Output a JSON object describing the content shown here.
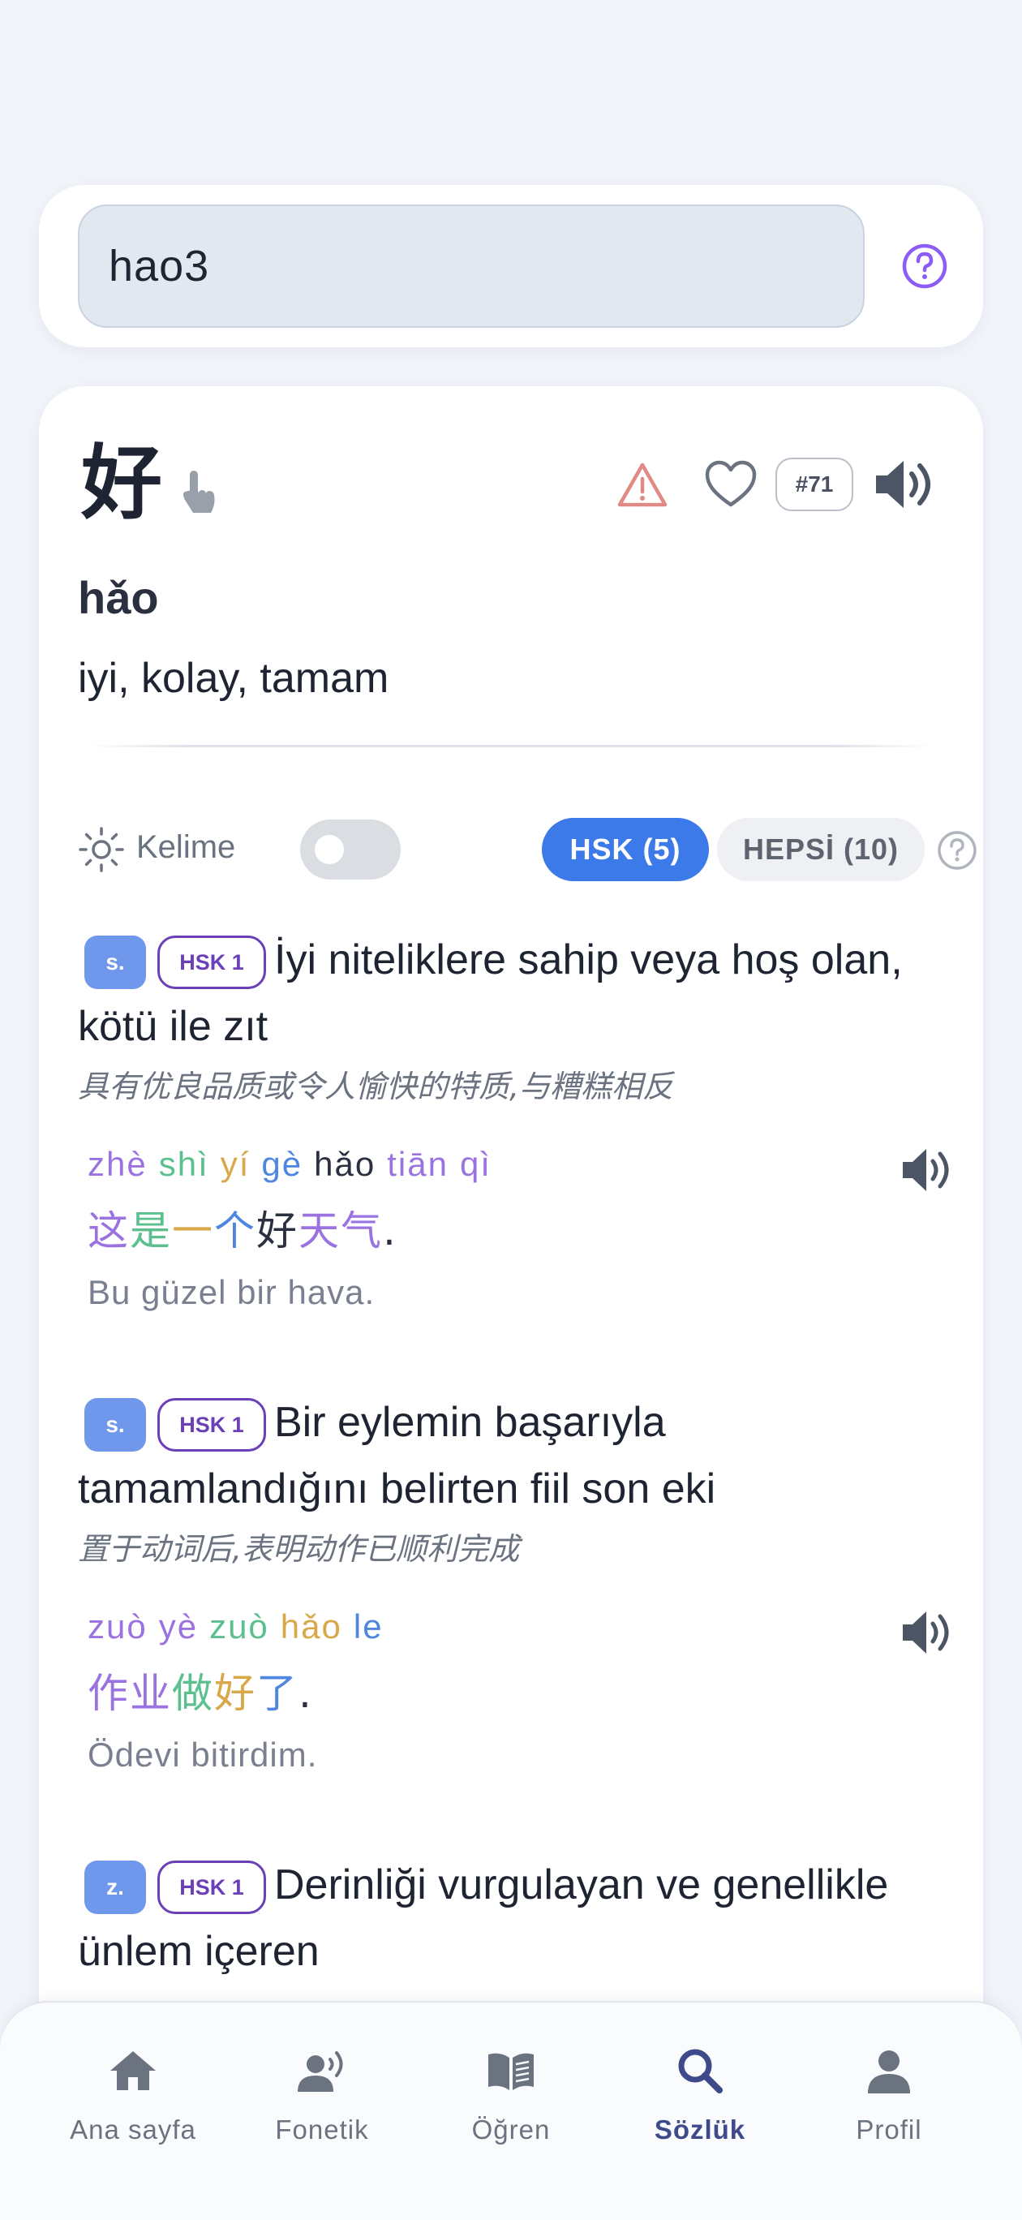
{
  "search": {
    "value": "hao3"
  },
  "entry": {
    "hanzi": "好",
    "rank": "#71",
    "pinyin": "hǎo",
    "meaning": "iyi, kolay, tamam"
  },
  "filters": {
    "word_label": "Kelime",
    "hsk_label": "HSK (5)",
    "all_label": "HEPSİ (10)"
  },
  "senses": [
    {
      "pos": "s.",
      "hsk": "HSK 1",
      "definition": "İyi niteliklere sahip veya hoş olan, kötü ile zıt",
      "zh": "具有优良品质或令人愉快的特质,与糟糕相反",
      "example": {
        "pinyin": [
          "zhè",
          "shì",
          "yí",
          "gè",
          "hǎo",
          "tiān",
          "qì"
        ],
        "hanzi": [
          "这",
          "是",
          "一",
          "个",
          "好",
          "天气",
          "."
        ],
        "translation": "Bu güzel bir hava."
      }
    },
    {
      "pos": "s.",
      "hsk": "HSK 1",
      "definition": "Bir eylemin başarıyla tamamlandığını belirten fiil son eki",
      "zh": "置于动词后,表明动作已顺利完成",
      "example": {
        "pinyin": [
          "zuò",
          "yè",
          "zuò",
          "hǎo",
          "le"
        ],
        "hanzi": [
          "作业",
          "做",
          "好",
          "了",
          "."
        ],
        "translation": "Ödevi bitirdim."
      }
    },
    {
      "pos": "z.",
      "hsk": "HSK 1",
      "definition": "Derinliği vurgulayan ve genellikle ünlem içeren"
    }
  ],
  "nav": {
    "home": "Ana sayfa",
    "phonetic": "Fonetik",
    "learn": "Öğren",
    "dictionary": "Sözlük",
    "profile": "Profil"
  },
  "colors": {
    "accent": "#3b7ae8",
    "hsk_badge": "#6a3fb8",
    "pos_badge": "#6f98ec",
    "nav_active": "#3f4a8a"
  }
}
